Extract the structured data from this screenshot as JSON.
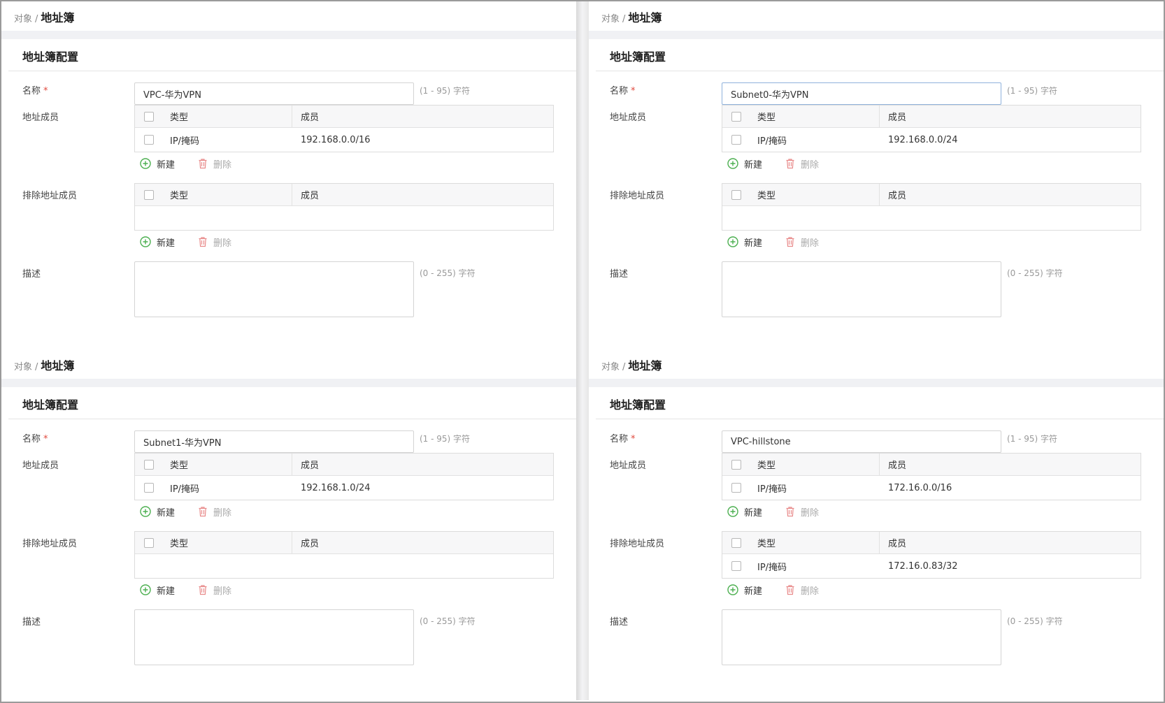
{
  "common": {
    "breadcrumb_parent": "对象",
    "breadcrumb_sep": "/",
    "breadcrumb_current": "地址簿",
    "card_title": "地址簿配置",
    "name_label": "名称",
    "required_mark": "*",
    "name_hint": "(1 - 95) 字符",
    "members_label": "地址成员",
    "exclude_label": "排除地址成员",
    "col_type": "类型",
    "col_member": "成员",
    "add_label": "新建",
    "delete_label": "删除",
    "desc_label": "描述",
    "desc_hint": "(0 - 255) 字符"
  },
  "colors": {
    "add_icon": "#4caf50",
    "delete_icon": "#e88a8a",
    "required": "#e04a3f"
  },
  "panels": [
    {
      "name_value": "VPC-华为VPN",
      "members": [
        {
          "type": "IP/掩码",
          "member": "192.168.0.0/16"
        }
      ],
      "exclude": []
    },
    {
      "name_value": "Subnet0-华为VPN",
      "members": [
        {
          "type": "IP/掩码",
          "member": "192.168.0.0/24"
        }
      ],
      "exclude": []
    },
    {
      "name_value": "Subnet1-华为VPN",
      "members": [
        {
          "type": "IP/掩码",
          "member": "192.168.1.0/24"
        }
      ],
      "exclude": []
    },
    {
      "name_value": "VPC-hillstone",
      "members": [
        {
          "type": "IP/掩码",
          "member": "172.16.0.0/16"
        }
      ],
      "exclude": [
        {
          "type": "IP/掩码",
          "member": "172.16.0.83/32"
        }
      ]
    }
  ]
}
